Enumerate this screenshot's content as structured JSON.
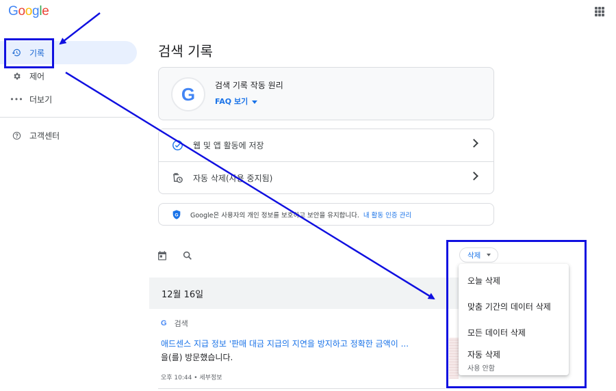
{
  "header": {
    "logo_letters": [
      "G",
      "o",
      "o",
      "g",
      "l",
      "e"
    ],
    "logo_colors": [
      "#4285f4",
      "#ea4335",
      "#fbbc05",
      "#4285f4",
      "#34a853",
      "#ea4335"
    ],
    "apps_icon": "apps-grid-icon"
  },
  "sidebar": {
    "items": [
      {
        "label": "기록",
        "icon": "history-icon",
        "active": true
      },
      {
        "label": "제어",
        "icon": "gear-icon",
        "active": false
      },
      {
        "label": "더보기",
        "icon": "more-horiz-icon",
        "active": false
      }
    ],
    "help": {
      "label": "고객센터",
      "icon": "help-circle-icon"
    }
  },
  "main": {
    "title": "검색 기록",
    "info_card": {
      "title": "검색 기록 작동 원리",
      "link": "FAQ 보기"
    },
    "settings": [
      {
        "label": "웹 및 앱 활동에 저장",
        "icon": "check-circle-icon"
      },
      {
        "label": "자동 삭제(사용 중지됨)",
        "icon": "auto-delete-icon"
      }
    ],
    "privacy": {
      "text": "Google은 사용자의 개인 정보를 보호하고 보안을 유지합니다.",
      "link": "내 활동 인증 관리"
    },
    "toolbar": {
      "calendar_icon": "calendar-icon",
      "search_icon": "search-icon",
      "delete_label": "삭제"
    },
    "date_header": "12월 16일",
    "entry": {
      "source": "검색",
      "link_text": "애드센스 지급 정보 '판매 대금 지급의 지연을 방지하고 정확한 금액이 ...",
      "tail_text": "을(를) 방문했습니다.",
      "meta": "오후 10:44 • 세부정보"
    }
  },
  "delete_menu": {
    "items": [
      {
        "label": "오늘 삭제"
      },
      {
        "label": "맞춤 기간의 데이터 삭제"
      },
      {
        "label": "모든 데이터 삭제"
      },
      {
        "label": "자동 삭제",
        "sub": "사용 안함"
      }
    ]
  },
  "colors": {
    "accent": "#1a73e8",
    "active_bg": "#e8f0fe",
    "annotation": "#1010e0"
  }
}
